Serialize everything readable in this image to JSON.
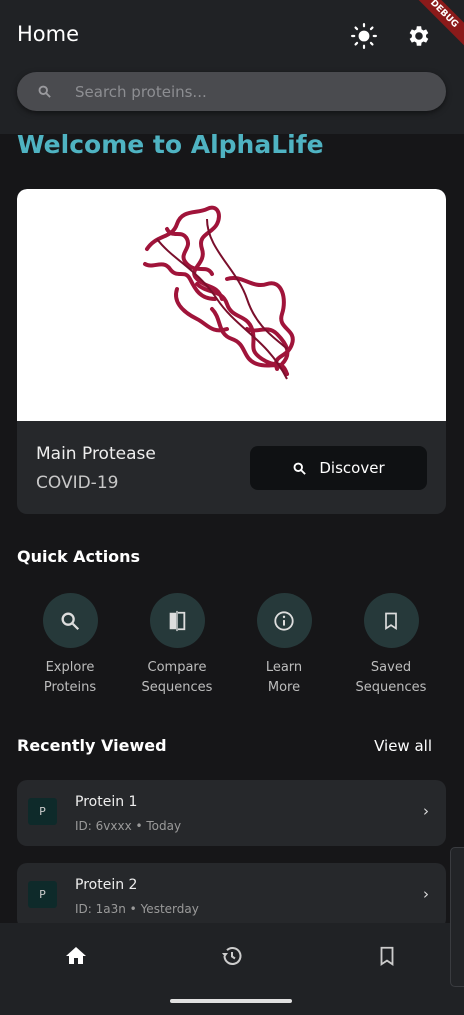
{
  "appbar": {
    "title": "Home",
    "debug_label": "DEBUG"
  },
  "search": {
    "placeholder": "Search proteins..."
  },
  "welcome": "Welcome to AlphaLife",
  "featured": {
    "name": "Main Protease",
    "subtitle": "COVID-19",
    "button": "Discover",
    "ribbon_color": "#a0143a"
  },
  "quick_actions": {
    "title": "Quick Actions",
    "items": [
      {
        "line1": "Explore",
        "line2": "Proteins",
        "icon": "search-icon"
      },
      {
        "line1": "Compare",
        "line2": "Sequences",
        "icon": "compare-icon"
      },
      {
        "line1": "Learn",
        "line2": "More",
        "icon": "info-icon"
      },
      {
        "line1": "Saved",
        "line2": "Sequences",
        "icon": "bookmark-icon"
      }
    ]
  },
  "recent": {
    "title": "Recently Viewed",
    "view_all": "View all",
    "items": [
      {
        "avatar": "P",
        "name": "Protein 1",
        "meta": "ID: 6vxxx • Today"
      },
      {
        "avatar": "P",
        "name": "Protein 2",
        "meta": "ID: 1a3n • Yesterday"
      }
    ]
  },
  "colors": {
    "accent": "#4fb3c2",
    "circle": "#26393a"
  }
}
